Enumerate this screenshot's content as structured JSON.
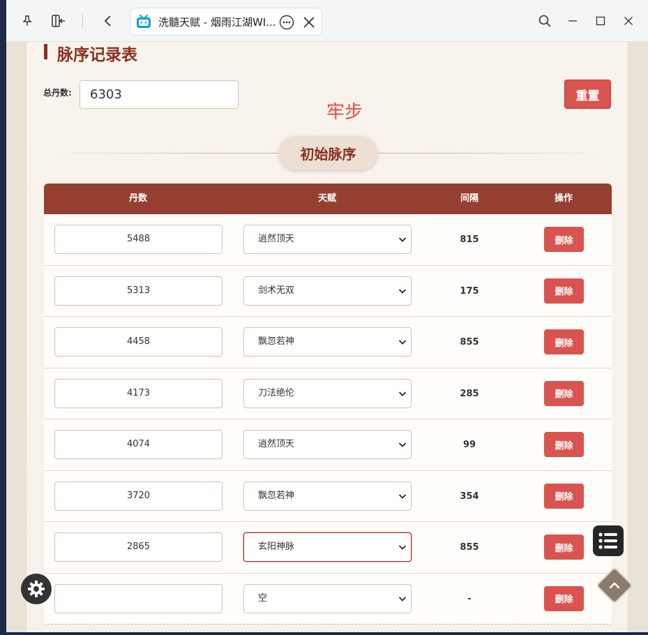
{
  "tab": {
    "title": "洗髓天赋 - 烟雨江湖WI..."
  },
  "page": {
    "heading": "脉序记录表",
    "total_label": "总丹数:",
    "total_value": "6303",
    "reset_label": "重置",
    "status_text": "牢步",
    "section_title": "初始脉序"
  },
  "table": {
    "headers": [
      "丹数",
      "天赋",
      "间隔",
      "操作"
    ],
    "rows": [
      {
        "dan": "5488",
        "talent": "逍然顶天",
        "gap": "815",
        "action": "删除"
      },
      {
        "dan": "5313",
        "talent": "剑术无双",
        "gap": "175",
        "action": "删除"
      },
      {
        "dan": "4458",
        "talent": "飘忽若神",
        "gap": "855",
        "action": "删除"
      },
      {
        "dan": "4173",
        "talent": "刀法绝伦",
        "gap": "285",
        "action": "删除"
      },
      {
        "dan": "4074",
        "talent": "逍然顶天",
        "gap": "99",
        "action": "删除"
      },
      {
        "dan": "3720",
        "talent": "飘忽若神",
        "gap": "354",
        "action": "删除"
      },
      {
        "dan": "2865",
        "talent": "玄阳神脉",
        "gap": "855",
        "action": "删除"
      },
      {
        "dan": "",
        "talent": "空",
        "gap": "-",
        "action": "删除"
      }
    ]
  },
  "colors": {
    "accent": "#953f31",
    "danger": "#d9534f",
    "status": "#e74c3c"
  }
}
